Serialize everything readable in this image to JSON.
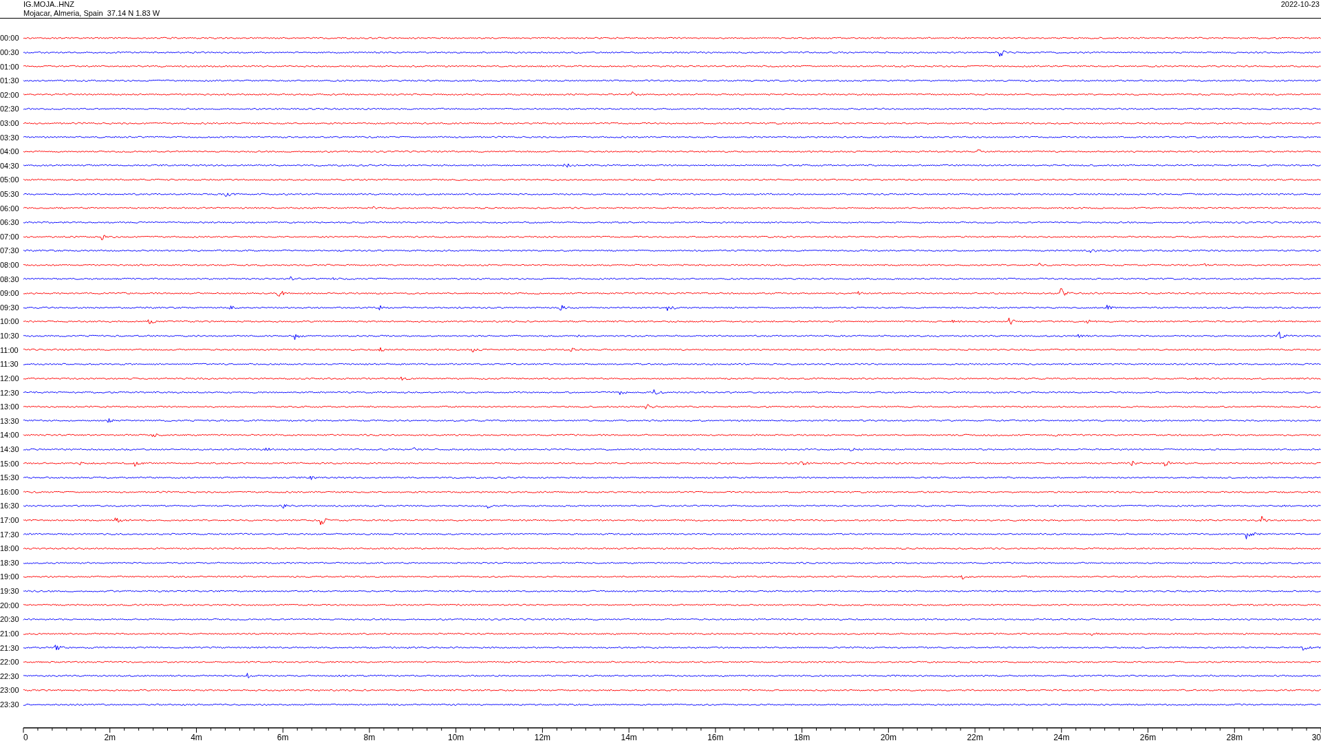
{
  "header": {
    "channel": "IG.MOJA..HNZ",
    "location": "Mojacar, Almeria, Spain  37.14 N 1.83 W",
    "date": "2022-10-23"
  },
  "traces": [
    {
      "time": "00:00",
      "color": "#ff0000"
    },
    {
      "time": "00:30",
      "color": "#0000ff"
    },
    {
      "time": "01:00",
      "color": "#ff0000"
    },
    {
      "time": "01:30",
      "color": "#0000ff"
    },
    {
      "time": "02:00",
      "color": "#ff0000"
    },
    {
      "time": "02:30",
      "color": "#0000ff"
    },
    {
      "time": "03:00",
      "color": "#ff0000"
    },
    {
      "time": "03:30",
      "color": "#0000ff"
    },
    {
      "time": "04:00",
      "color": "#ff0000"
    },
    {
      "time": "04:30",
      "color": "#0000ff"
    },
    {
      "time": "05:00",
      "color": "#ff0000"
    },
    {
      "time": "05:30",
      "color": "#0000ff"
    },
    {
      "time": "06:00",
      "color": "#ff0000"
    },
    {
      "time": "06:30",
      "color": "#0000ff"
    },
    {
      "time": "07:00",
      "color": "#ff0000"
    },
    {
      "time": "07:30",
      "color": "#0000ff"
    },
    {
      "time": "08:00",
      "color": "#ff0000"
    },
    {
      "time": "08:30",
      "color": "#0000ff"
    },
    {
      "time": "09:00",
      "color": "#ff0000"
    },
    {
      "time": "09:30",
      "color": "#0000ff"
    },
    {
      "time": "10:00",
      "color": "#ff0000"
    },
    {
      "time": "10:30",
      "color": "#0000ff"
    },
    {
      "time": "11:00",
      "color": "#ff0000"
    },
    {
      "time": "11:30",
      "color": "#0000ff"
    },
    {
      "time": "12:00",
      "color": "#ff0000"
    },
    {
      "time": "12:30",
      "color": "#0000ff"
    },
    {
      "time": "13:00",
      "color": "#ff0000"
    },
    {
      "time": "13:30",
      "color": "#0000ff"
    },
    {
      "time": "14:00",
      "color": "#ff0000"
    },
    {
      "time": "14:30",
      "color": "#0000ff"
    },
    {
      "time": "15:00",
      "color": "#ff0000"
    },
    {
      "time": "15:30",
      "color": "#0000ff"
    },
    {
      "time": "16:00",
      "color": "#ff0000"
    },
    {
      "time": "16:30",
      "color": "#0000ff"
    },
    {
      "time": "17:00",
      "color": "#ff0000"
    },
    {
      "time": "17:30",
      "color": "#0000ff"
    },
    {
      "time": "18:00",
      "color": "#ff0000"
    },
    {
      "time": "18:30",
      "color": "#0000ff"
    },
    {
      "time": "19:00",
      "color": "#ff0000"
    },
    {
      "time": "19:30",
      "color": "#0000ff"
    },
    {
      "time": "20:00",
      "color": "#ff0000"
    },
    {
      "time": "20:30",
      "color": "#0000ff"
    },
    {
      "time": "21:00",
      "color": "#ff0000"
    },
    {
      "time": "21:30",
      "color": "#0000ff"
    },
    {
      "time": "22:00",
      "color": "#ff0000"
    },
    {
      "time": "22:30",
      "color": "#0000ff"
    },
    {
      "time": "23:00",
      "color": "#ff0000"
    },
    {
      "time": "23:30",
      "color": "#0000ff"
    }
  ],
  "axis": {
    "ticks": [
      "0",
      "2m",
      "4m",
      "6m",
      "8m",
      "10m",
      "12m",
      "14m",
      "16m",
      "18m",
      "20m",
      "22m",
      "24m",
      "26m",
      "28m",
      "30"
    ]
  }
}
